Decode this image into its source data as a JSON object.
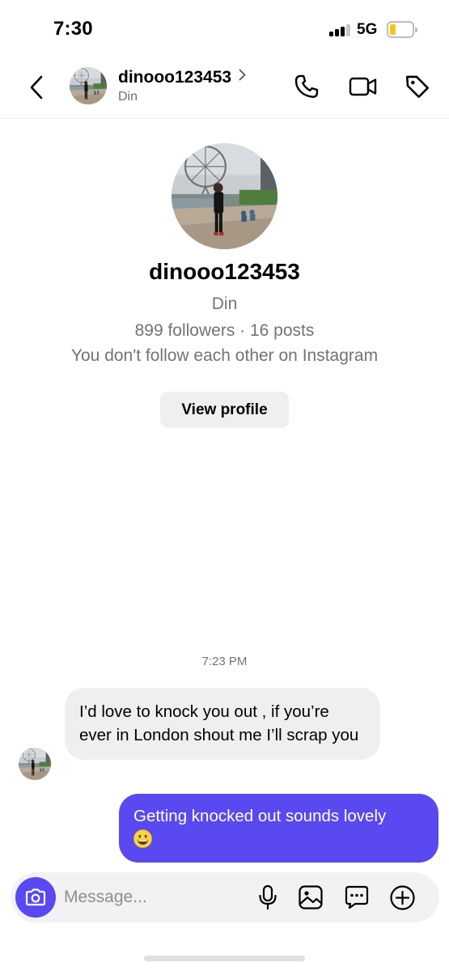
{
  "status_bar": {
    "time": "7:30",
    "network": "5G",
    "battery_level": 0.25,
    "battery_color": "#f5c518"
  },
  "header": {
    "username": "dinooo123453",
    "display_name": "Din",
    "icons": [
      "back-chevron-icon",
      "chevron-right-icon",
      "phone-icon",
      "video-camera-icon",
      "tag-icon"
    ]
  },
  "profile": {
    "username": "dinooo123453",
    "display_name": "Din",
    "stats": "899 followers · 16 posts",
    "follow_status": "You don't follow each other on Instagram",
    "view_profile_label": "View profile"
  },
  "conversation": {
    "timestamp": "7:23 PM",
    "messages": [
      {
        "from": "them",
        "text": "I’d love to knock you out , if you’re ever in London shout me I’ll scrap you"
      },
      {
        "from": "me",
        "text": "Getting knocked out sounds lovely",
        "emoji": "grinning-face-emoji"
      }
    ]
  },
  "composer": {
    "placeholder": "Message...",
    "icons": [
      "camera-icon",
      "microphone-icon",
      "image-icon",
      "sticker-chat-icon",
      "plus-circle-icon"
    ]
  },
  "colors": {
    "accent": "#5a48f0",
    "incoming_bubble": "#efefef",
    "secondary_text": "#737373"
  }
}
